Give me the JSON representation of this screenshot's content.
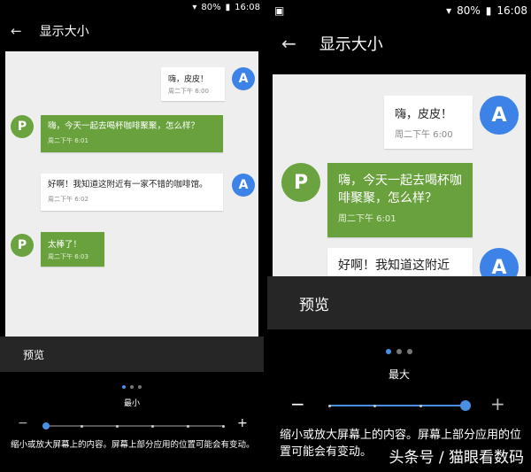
{
  "left": {
    "status": {
      "battery": "80%",
      "time": "16:08"
    },
    "title": "显示大小",
    "messages": [
      {
        "text": "嗨，皮皮！",
        "time": "周二下午 6:00",
        "avatar": "A"
      },
      {
        "text": "嗨，今天一起去喝杯咖啡聚聚，怎么样？",
        "time": "周二下午 6:01",
        "avatar": "P"
      },
      {
        "text": "好啊！我知道这附近有一家不错的咖啡馆。",
        "time": "周二下午 6:02",
        "avatar": "A"
      },
      {
        "text": "太棒了！",
        "time": "周二下午 6:03",
        "avatar": "P"
      }
    ],
    "preview_label": "预览",
    "size_label": "最小",
    "slider": {
      "minus": "−",
      "plus": "+",
      "level_index": 0,
      "level_count": 6
    },
    "description": "缩小或放大屏幕上的内容。屏幕上部分应用的位置可能会有变动。"
  },
  "right": {
    "status": {
      "battery": "80%",
      "time": "16:08"
    },
    "title": "显示大小",
    "messages": [
      {
        "text": "嗨，皮皮！",
        "time": "周二下午 6:00",
        "avatar": "A"
      },
      {
        "text": "嗨，今天一起去喝杯咖啡聚聚，怎么样？",
        "time": "周二下午 6:01",
        "avatar": "P"
      },
      {
        "text": "好啊！我知道这附近",
        "time": "",
        "avatar": "A"
      }
    ],
    "preview_label": "预览",
    "size_label": "最大",
    "slider": {
      "minus": "−",
      "plus": "+",
      "level_index": 3,
      "level_count": 4
    },
    "description": "缩小或放大屏幕上的内容。屏幕上部分应用的位置可能会有变动。"
  },
  "watermark": "头条号 / 猫眼看数码",
  "colors": {
    "accent": "#4a90e2",
    "bubble_green": "#69a13d",
    "avatar_blue": "#3d82e6"
  }
}
